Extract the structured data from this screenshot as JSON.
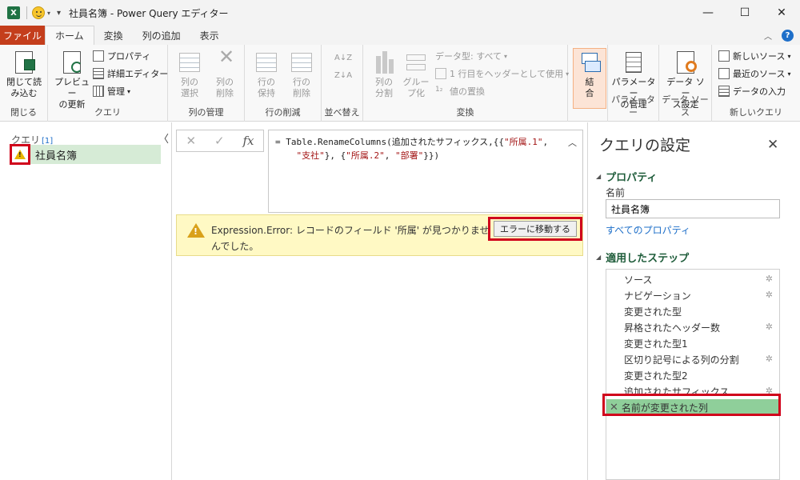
{
  "window": {
    "title": "社員名簿 - Power Query エディター",
    "app_icon": "X",
    "minimize_glyph": "—",
    "maximize_glyph": "☐",
    "close_glyph": "✕"
  },
  "tabs": [
    {
      "label": "ファイル"
    },
    {
      "label": "ホーム"
    },
    {
      "label": "変換"
    },
    {
      "label": "列の追加"
    },
    {
      "label": "表示"
    }
  ],
  "ribbon": {
    "close_group": {
      "label": "閉じる",
      "close_load": "閉じて読\nみ込む"
    },
    "query_group": {
      "label": "クエリ",
      "refresh_preview": "プレビュー\nの更新",
      "properties": "プロパティ",
      "advanced_editor": "詳細エディター",
      "manage": "管理"
    },
    "manage_columns": {
      "label": "列の管理",
      "choose_columns": "列の\n選択",
      "remove_columns": "列の\n削除"
    },
    "reduce_rows": {
      "label": "行の削減",
      "keep_rows": "行の\n保持",
      "remove_rows": "行の\n削除"
    },
    "sort": {
      "label": "並べ替え"
    },
    "transform": {
      "label": "変換",
      "split_column": "列の\n分割",
      "group_by": "グルー\nプ化",
      "data_type": "データ型: すべて",
      "use_first_row": "1 行目をヘッダーとして使用",
      "replace_values": "値の置換"
    },
    "combine": {
      "label": "結\n合"
    },
    "parameters": {
      "label": "パラメーター",
      "manage_params": "パラメーター\nの管理"
    },
    "data_sources": {
      "label": "データ ソース",
      "settings": "データ ソー\nス設定"
    },
    "new_query": {
      "label": "新しいクエリ",
      "new_source": "新しいソース",
      "recent_sources": "最近のソース",
      "enter_data": "データの入力"
    }
  },
  "queries_panel": {
    "header": "クエリ",
    "count": "[1]",
    "items": [
      {
        "name": "社員名簿"
      }
    ]
  },
  "formula_bar": {
    "cancel": "✕",
    "commit": "✓",
    "fx": "fx",
    "line1_prefix": "= Table.RenameColumns(追加されたサフィックス,{{",
    "line1_str": "\"所属.1\"",
    "line1_suffix": ",",
    "line2_str1": "\"支社\"",
    "line2_mid": "}, {",
    "line2_str2": "\"所属.2\"",
    "line2_comma": ", ",
    "line2_str3": "\"部署\"",
    "line2_end": "}})"
  },
  "error": {
    "message": "Expression.Error: レコードのフィールド '所属' が見つかりませんでした。",
    "goto_button": "エラーに移動する"
  },
  "settings_pane": {
    "title": "クエリの設定",
    "properties_section": "プロパティ",
    "name_label": "名前",
    "name_value": "社員名簿",
    "all_properties_link": "すべてのプロパティ",
    "steps_section": "適用したステップ",
    "steps": [
      {
        "label": "ソース",
        "gear": true
      },
      {
        "label": "ナビゲーション",
        "gear": true
      },
      {
        "label": "変更された型",
        "gear": false
      },
      {
        "label": "昇格されたヘッダー数",
        "gear": true
      },
      {
        "label": "変更された型1",
        "gear": false
      },
      {
        "label": "区切り記号による列の分割",
        "gear": true
      },
      {
        "label": "変更された型2",
        "gear": false
      },
      {
        "label": "追加されたサフィックス",
        "gear": true
      },
      {
        "label": "名前が変更された列",
        "gear": false,
        "selected": true
      }
    ]
  },
  "colors": {
    "file_tab": "#c43e1c",
    "excel_green": "#1f7244",
    "selection_green": "#8fcf9a",
    "highlight_red": "#d0021b",
    "error_bg": "#fff9c4"
  }
}
